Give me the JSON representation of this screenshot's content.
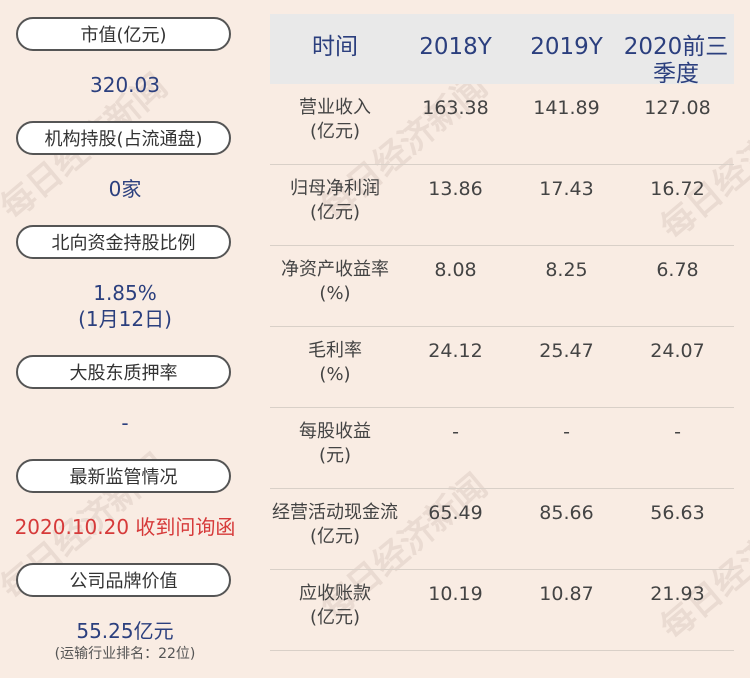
{
  "left_panel": {
    "items": [
      {
        "label": "市值(亿元)",
        "value": "320.03"
      },
      {
        "label": "机构持股(占流通盘)",
        "value": "0家"
      },
      {
        "label": "北向资金持股比例",
        "value": "1.85%",
        "value2": "(1月12日)"
      },
      {
        "label": "大股东质押率",
        "value": "-"
      },
      {
        "label": "最新监管情况",
        "value": "2020.10.20 收到问询函"
      },
      {
        "label": "公司品牌价值",
        "value": "55.25亿元",
        "note": "(运输行业排名：22位)"
      }
    ]
  },
  "table": {
    "headers": [
      "时间",
      "2018Y",
      "2019Y",
      "2020前三季度"
    ],
    "rows": [
      {
        "label1": "营业收入",
        "label2": "(亿元)",
        "values": [
          "163.38",
          "141.89",
          "127.08"
        ]
      },
      {
        "label1": "归母净利润",
        "label2": "(亿元)",
        "values": [
          "13.86",
          "17.43",
          "16.72"
        ]
      },
      {
        "label1": "净资产收益率",
        "label2": "(%)",
        "values": [
          "8.08",
          "8.25",
          "6.78"
        ]
      },
      {
        "label1": "毛利率",
        "label2": "(%)",
        "values": [
          "24.12",
          "25.47",
          "24.07"
        ]
      },
      {
        "label1": "每股收益",
        "label2": "(元)",
        "values": [
          "-",
          "-",
          "-"
        ]
      },
      {
        "label1": "经营活动现金流",
        "label2": "(亿元)",
        "values": [
          "65.49",
          "85.66",
          "56.63"
        ]
      },
      {
        "label1": "应收账款",
        "label2": "(亿元)",
        "values": [
          "10.19",
          "10.87",
          "21.93"
        ]
      }
    ]
  },
  "watermark": {
    "text": "每日经济新闻"
  },
  "colors": {
    "background": "#f9ece3",
    "accent": "#2b3f7e",
    "alert": "#d63a3a",
    "header_bg": "#e9e9e9"
  }
}
